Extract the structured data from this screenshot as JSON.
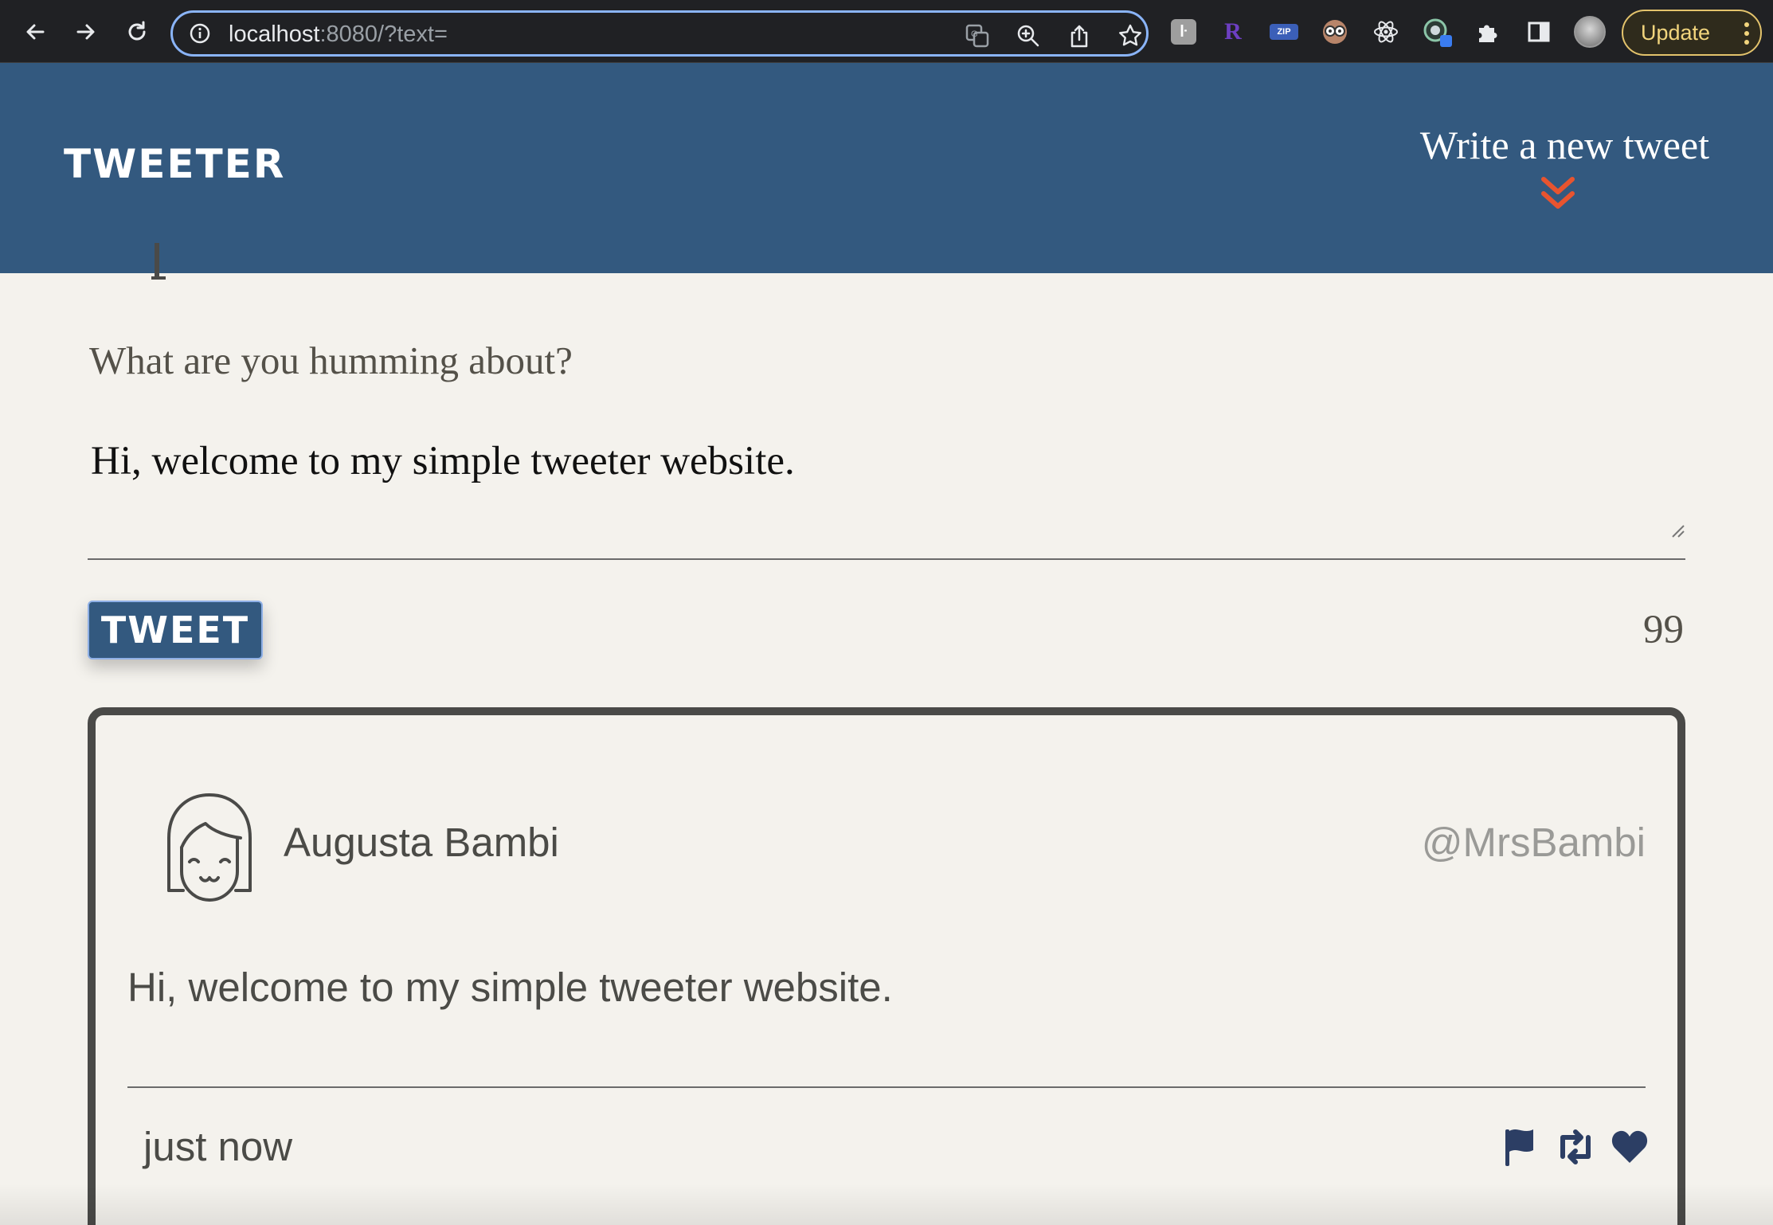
{
  "browser": {
    "url_host": "localhost",
    "url_rest": ":8080/?text=",
    "update_label": "Update",
    "icons": [
      "back-icon",
      "forward-icon",
      "reload-icon",
      "info-icon",
      "translate-icon",
      "zoom-icon",
      "share-icon",
      "star-icon",
      "extension-icon",
      "puzzle-icon",
      "sidepanel-icon",
      "profile-avatar",
      "menu-dots-icon"
    ]
  },
  "header": {
    "logo": "TWEETER",
    "compose_link": "Write a new tweet",
    "chevron_icon": "double-chevron-down-icon",
    "colors": {
      "background": "#33597f",
      "chevron": "#e8542f"
    }
  },
  "compose": {
    "label": "What are you humming about?",
    "text": "Hi, welcome to my simple tweeter website.",
    "button_label": "TWEET",
    "counter": "99"
  },
  "tweet": {
    "name": "Augusta Bambi",
    "handle": "@MrsBambi",
    "text": "Hi, welcome to my simple tweeter website.",
    "time": "just now",
    "actions": [
      "flag-icon",
      "retweet-icon",
      "heart-icon"
    ],
    "colors": {
      "action": "#2c3e64",
      "border": "#4a4a48"
    }
  }
}
